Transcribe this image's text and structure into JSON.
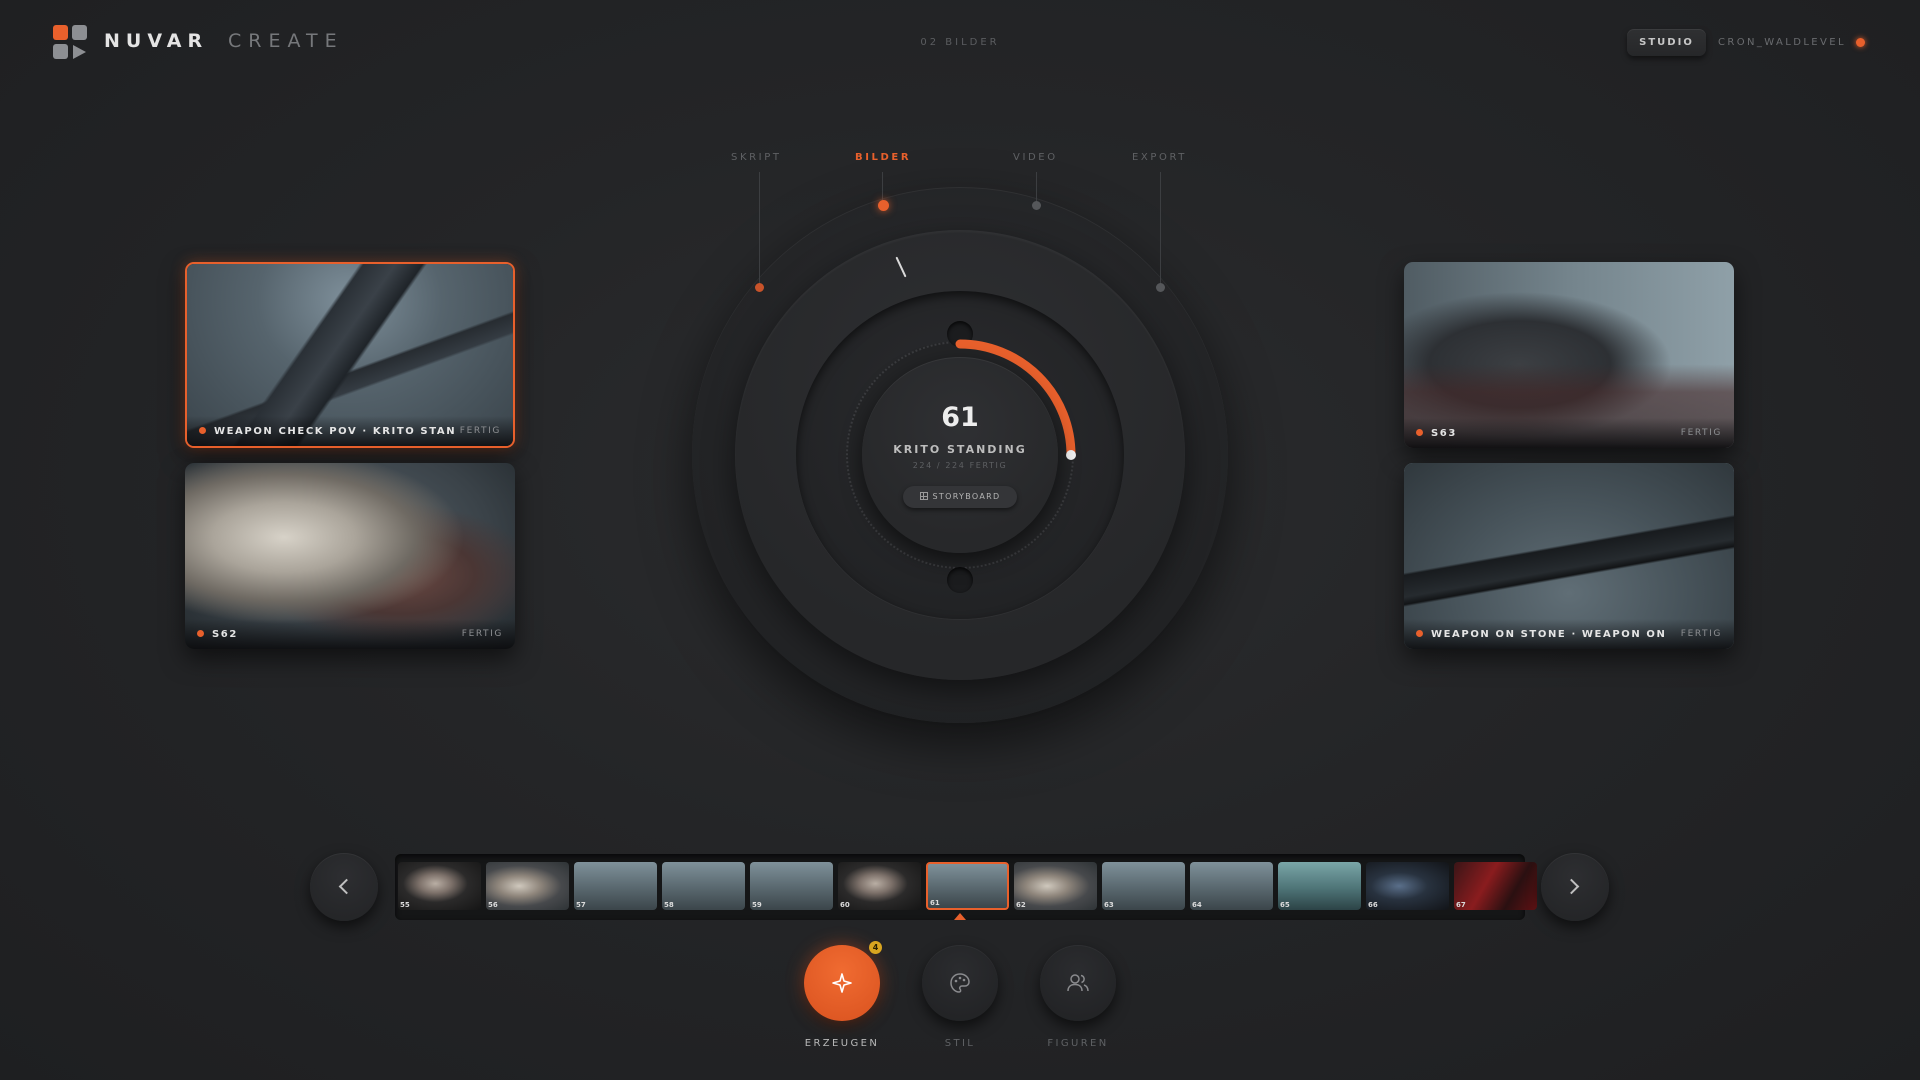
{
  "header": {
    "brand": "NUVAR",
    "brand_sub": "CREATE",
    "center_label": "02 BILDER",
    "studio_button": "STUDIO",
    "user_name": "CRON_WALDLEVEL",
    "accent_color": "#e8602c"
  },
  "stages": [
    {
      "label": "SKRIPT",
      "state": "done"
    },
    {
      "label": "BILDER",
      "state": "active"
    },
    {
      "label": "VIDEO",
      "state": "pending"
    },
    {
      "label": "EXPORT",
      "state": "pending"
    }
  ],
  "dial": {
    "number": "61",
    "title": "KRITO STANDING",
    "subtitle": "224 / 224 FERTIG",
    "progress_fraction": 0.25,
    "button_label": "STORYBOARD",
    "button_icon": "grid-icon"
  },
  "cards": {
    "left_top": {
      "title": "WEAPON CHECK POV · KRITO STANDI…",
      "status": "FERTIG",
      "selected": true
    },
    "left_bottom": {
      "title": "S62",
      "status": "FERTIG"
    },
    "right_top": {
      "title": "S63",
      "status": "FERTIG"
    },
    "right_bottom": {
      "title": "WEAPON ON STONE · WEAPON ON COB…",
      "status": "FERTIG"
    }
  },
  "filmstrip": {
    "thumbs": [
      {
        "number": "55",
        "kind": "face"
      },
      {
        "number": "56",
        "kind": "monster"
      },
      {
        "number": "57",
        "kind": "field"
      },
      {
        "number": "58",
        "kind": "field"
      },
      {
        "number": "59",
        "kind": "field"
      },
      {
        "number": "60",
        "kind": "face"
      },
      {
        "number": "61",
        "kind": "field",
        "selected": true
      },
      {
        "number": "62",
        "kind": "monster"
      },
      {
        "number": "63",
        "kind": "field"
      },
      {
        "number": "64",
        "kind": "field"
      },
      {
        "number": "65",
        "kind": "teal"
      },
      {
        "number": "66",
        "kind": "dark"
      },
      {
        "number": "67",
        "kind": "red"
      }
    ],
    "prev_icon": "chevron-left-icon",
    "next_icon": "chevron-right-icon"
  },
  "actions": [
    {
      "label": "ERZEUGEN",
      "icon": "sparkle-icon",
      "active": true,
      "badge": "4"
    },
    {
      "label": "STIL",
      "icon": "palette-icon",
      "active": false
    },
    {
      "label": "FIGUREN",
      "icon": "people-icon",
      "active": false
    }
  ]
}
